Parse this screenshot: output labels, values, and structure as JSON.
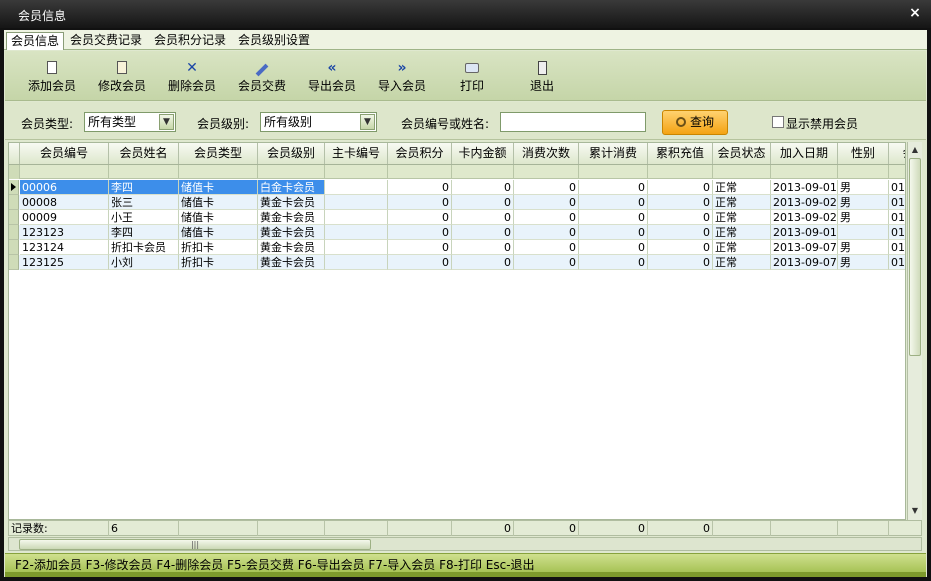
{
  "window": {
    "title": "会员信息",
    "close_glyph": "×"
  },
  "tabs": [
    {
      "label": "会员信息",
      "active": true
    },
    {
      "label": "会员交费记录",
      "active": false
    },
    {
      "label": "会员积分记录",
      "active": false
    },
    {
      "label": "会员级别设置",
      "active": false
    }
  ],
  "toolbar": [
    {
      "label": "添加会员",
      "icon": "add-document-icon"
    },
    {
      "label": "修改会员",
      "icon": "edit-document-icon"
    },
    {
      "label": "删除会员",
      "icon": "delete-x-icon"
    },
    {
      "label": "会员交费",
      "icon": "pen-icon"
    },
    {
      "label": "导出会员",
      "icon": "double-left-arrow-icon"
    },
    {
      "label": "导入会员",
      "icon": "double-right-arrow-icon"
    },
    {
      "label": "打印",
      "icon": "printer-icon"
    },
    {
      "label": "退出",
      "icon": "exit-door-icon"
    }
  ],
  "search": {
    "type_label": "会员类型:",
    "type_value": "所有类型",
    "level_label": "会员级别:",
    "level_value": "所有级别",
    "keyword_label": "会员编号或姓名:",
    "keyword_value": "",
    "query_button": "查询",
    "show_disabled_label": "显示禁用会员",
    "show_disabled_checked": false
  },
  "grid": {
    "columns": [
      "会员编号",
      "会员姓名",
      "会员类型",
      "会员级别",
      "主卡编号",
      "会员积分",
      "卡内金额",
      "消费次数",
      "累计消费",
      "累积充值",
      "会员状态",
      "加入日期",
      "性别",
      "会"
    ],
    "rows": [
      [
        "00006",
        "李四",
        "储值卡",
        "白金卡会员",
        "",
        "0",
        "0",
        "0",
        "0",
        "0",
        "正常",
        "2013-09-01",
        "男",
        "01-"
      ],
      [
        "00008",
        "张三",
        "储值卡",
        "黄金卡会员",
        "",
        "0",
        "0",
        "0",
        "0",
        "0",
        "正常",
        "2013-09-02",
        "男",
        "01-"
      ],
      [
        "00009",
        "小王",
        "储值卡",
        "黄金卡会员",
        "",
        "0",
        "0",
        "0",
        "0",
        "0",
        "正常",
        "2013-09-02",
        "男",
        "01-"
      ],
      [
        "123123",
        "李四",
        "储值卡",
        "黄金卡会员",
        "",
        "0",
        "0",
        "0",
        "0",
        "0",
        "正常",
        "2013-09-01",
        "",
        "01-"
      ],
      [
        "123124",
        "折扣卡会员",
        "折扣卡",
        "黄金卡会员",
        "",
        "0",
        "0",
        "0",
        "0",
        "0",
        "正常",
        "2013-09-07",
        "男",
        "01-"
      ],
      [
        "123125",
        "小刘",
        "折扣卡",
        "黄金卡会员",
        "",
        "0",
        "0",
        "0",
        "0",
        "0",
        "正常",
        "2013-09-07",
        "男",
        "01-"
      ]
    ],
    "selected_row": 0
  },
  "summary": {
    "label": "记录数:",
    "count": "6",
    "values": [
      "",
      "",
      "",
      "",
      "0",
      "0",
      "0",
      "0",
      "",
      "",
      ""
    ]
  },
  "status": {
    "text": "F2-添加会员 F3-修改会员 F4-删除会员 F5-会员交费 F6-导出会员 F7-导入会员 F8-打印 Esc-退出"
  },
  "colors": {
    "selected": "#3d8eea",
    "alt_row": "#e9f3fb",
    "status_bar": "#a7c356",
    "query_button": "#f4a313"
  }
}
